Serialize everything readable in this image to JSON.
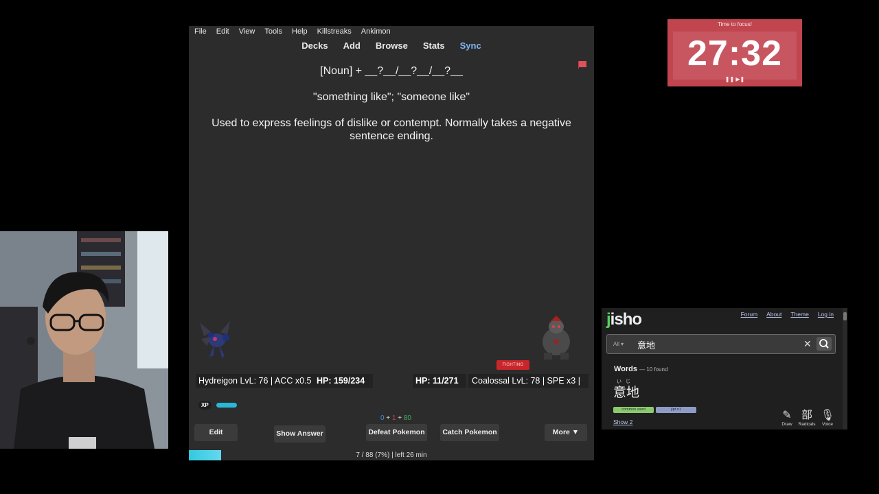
{
  "anki": {
    "menu": [
      "File",
      "Edit",
      "View",
      "Tools",
      "Help",
      "Killstreaks",
      "Ankimon"
    ],
    "toplinks": [
      "Decks",
      "Add",
      "Browse",
      "Stats",
      "Sync"
    ],
    "card": {
      "front": "[Noun] + __?__/__?__/__?__",
      "meaning": "\"something like\"; \"someone like\"",
      "usage": "Used to express feelings of dislike or contempt. Normally takes a negative sentence ending."
    },
    "battle": {
      "player_name": "Hydreigon LvL: 76 | ACC x0.5",
      "player_hp": "HP: 159/234",
      "enemy_hp": "HP: 11/271",
      "enemy_name": "Coalossal LvL: 78 | SPE x3 |",
      "enemy_type": "FIGHTING",
      "xp_label": "XP",
      "xp_fraction": 0.3
    },
    "counts": {
      "new": "0",
      "sep1": " + ",
      "learn": "1",
      "sep2": " + ",
      "review": "80"
    },
    "buttons": {
      "edit": "Edit",
      "show_answer": "Show Answer",
      "defeat": "Defeat Pokemon",
      "catch": "Catch Pokemon",
      "more": "More ▼"
    },
    "progress_fraction": 0.08,
    "status": "7 / 88 (7%) | left 26 min",
    "flag_color": "#e0505a"
  },
  "timer": {
    "title": "Time to focus!",
    "time": "27:32",
    "controls": "❚❚ ▶❚",
    "background": "#c0454e"
  },
  "jisho": {
    "logo_j": "j",
    "logo_rest": "isho",
    "nav": [
      "Forum",
      "About",
      "Theme",
      "Log in"
    ],
    "filter": "All ▾",
    "query": "意地",
    "words_heading": "Words",
    "words_count": "— 10 found",
    "furigana": "いじ",
    "word": "意地",
    "tags": [
      "common word",
      "jlpt n1"
    ],
    "show_more": "Show 2",
    "tools": [
      {
        "label": "Draw",
        "icon": "draw-icon"
      },
      {
        "label": "Radicals",
        "icon": "radicals-icon"
      },
      {
        "label": "Voice",
        "icon": "mic-icon"
      }
    ]
  }
}
